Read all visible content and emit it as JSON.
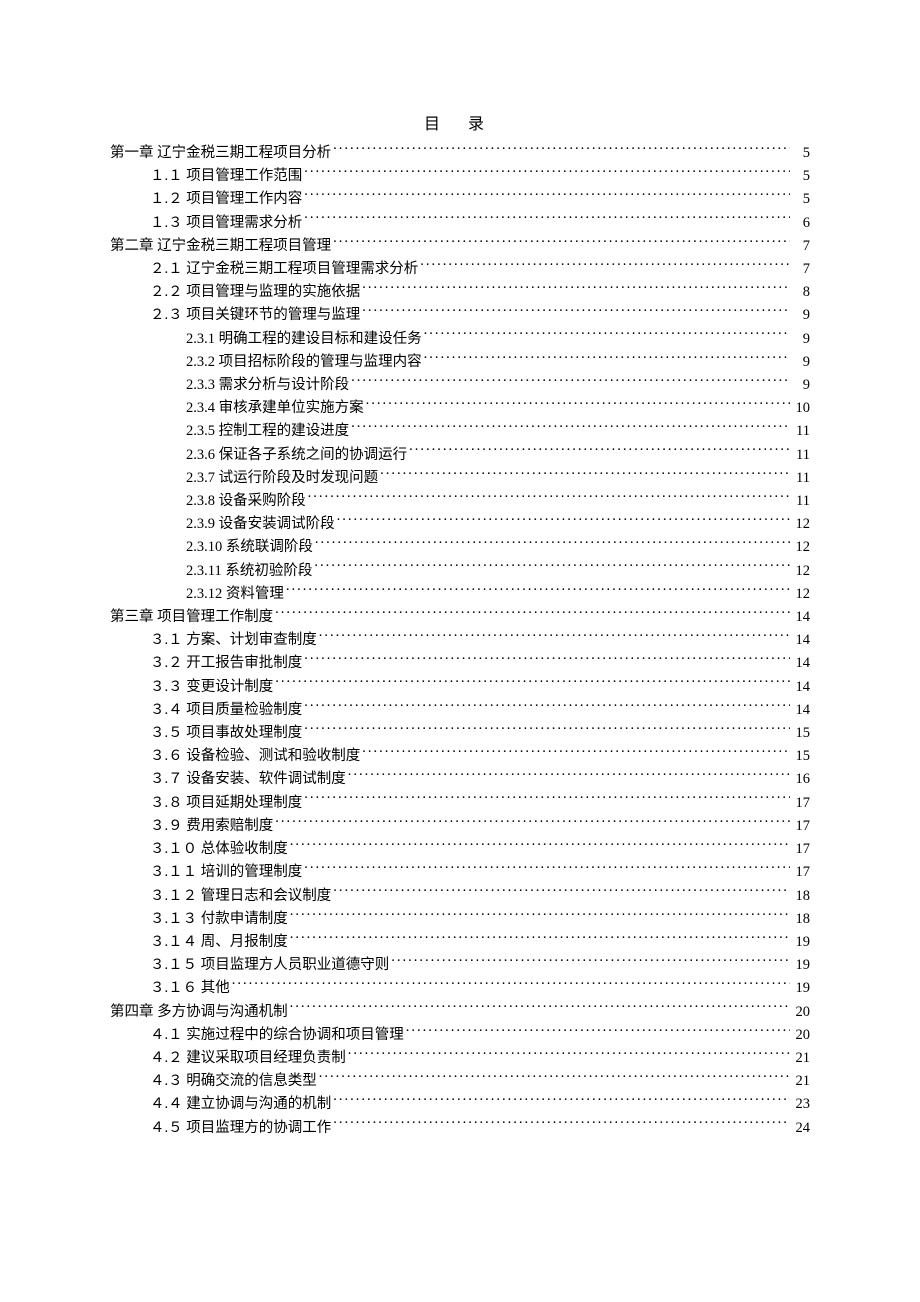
{
  "title": "目  录",
  "toc": [
    {
      "level": 0,
      "label": "第一章 辽宁金税三期工程项目分析",
      "page": "5"
    },
    {
      "level": 1,
      "label": "１.１ 项目管理工作范围",
      "page": "5"
    },
    {
      "level": 1,
      "label": "１.２ 项目管理工作内容",
      "page": "5"
    },
    {
      "level": 1,
      "label": "１.３ 项目管理需求分析",
      "page": "6"
    },
    {
      "level": 0,
      "label": "第二章 辽宁金税三期工程项目管理",
      "page": "7"
    },
    {
      "level": 1,
      "label": "２.１ 辽宁金税三期工程项目管理需求分析",
      "page": "7"
    },
    {
      "level": 1,
      "label": "２.２ 项目管理与监理的实施依据",
      "page": "8"
    },
    {
      "level": 1,
      "label": "２.３ 项目关键环节的管理与监理",
      "page": "9"
    },
    {
      "level": 2,
      "label": "2.3.1 明确工程的建设目标和建设任务",
      "page": "9"
    },
    {
      "level": 2,
      "label": "2.3.2 项目招标阶段的管理与监理内容",
      "page": "9"
    },
    {
      "level": 2,
      "label": "2.3.3 需求分析与设计阶段",
      "page": "9"
    },
    {
      "level": 2,
      "label": "2.3.4 审核承建单位实施方案",
      "page": "10"
    },
    {
      "level": 2,
      "label": "2.3.5 控制工程的建设进度",
      "page": "11"
    },
    {
      "level": 2,
      "label": "2.3.6 保证各子系统之间的协调运行",
      "page": "11"
    },
    {
      "level": 2,
      "label": "2.3.7 试运行阶段及时发现问题",
      "page": "11"
    },
    {
      "level": 2,
      "label": "2.3.8 设备采购阶段",
      "page": "11"
    },
    {
      "level": 2,
      "label": "2.3.9 设备安装调试阶段",
      "page": "12"
    },
    {
      "level": 2,
      "label": "2.3.10 系统联调阶段",
      "page": "12"
    },
    {
      "level": 2,
      "label": "2.3.11 系统初验阶段",
      "page": "12"
    },
    {
      "level": 2,
      "label": "2.3.12 资料管理",
      "page": "12"
    },
    {
      "level": 0,
      "label": "第三章 项目管理工作制度",
      "page": "14"
    },
    {
      "level": 1,
      "label": "３.１ 方案、计划审查制度",
      "page": "14"
    },
    {
      "level": 1,
      "label": "３.２ 开工报告审批制度",
      "page": "14"
    },
    {
      "level": 1,
      "label": "３.３ 变更设计制度",
      "page": "14"
    },
    {
      "level": 1,
      "label": "３.４ 项目质量检验制度",
      "page": "14"
    },
    {
      "level": 1,
      "label": "３.５ 项目事故处理制度",
      "page": "15"
    },
    {
      "level": 1,
      "label": "３.６ 设备检验、测试和验收制度",
      "page": "15"
    },
    {
      "level": 1,
      "label": "３.７ 设备安装、软件调试制度",
      "page": "16"
    },
    {
      "level": 1,
      "label": "３.８ 项目延期处理制度",
      "page": "17"
    },
    {
      "level": 1,
      "label": "３.９ 费用索赔制度",
      "page": "17"
    },
    {
      "level": 1,
      "label": "３.１０ 总体验收制度",
      "page": "17"
    },
    {
      "level": 1,
      "label": "３.１１ 培训的管理制度",
      "page": "17"
    },
    {
      "level": 1,
      "label": "３.１２ 管理日志和会议制度",
      "page": "18"
    },
    {
      "level": 1,
      "label": "３.１３ 付款申请制度",
      "page": "18"
    },
    {
      "level": 1,
      "label": "３.１４ 周、月报制度",
      "page": "19"
    },
    {
      "level": 1,
      "label": "３.１５ 项目监理方人员职业道德守则",
      "page": "19"
    },
    {
      "level": 1,
      "label": "３.１６ 其他",
      "page": "19"
    },
    {
      "level": 0,
      "label": "第四章 多方协调与沟通机制",
      "page": "20"
    },
    {
      "level": 1,
      "label": "４.１ 实施过程中的综合协调和项目管理",
      "page": "20"
    },
    {
      "level": 1,
      "label": "４.２ 建议采取项目经理负责制",
      "page": "21"
    },
    {
      "level": 1,
      "label": "４.３ 明确交流的信息类型",
      "page": "21"
    },
    {
      "level": 1,
      "label": "４.４ 建立协调与沟通的机制",
      "page": "23"
    },
    {
      "level": 1,
      "label": "４.５ 项目监理方的协调工作",
      "page": "24"
    }
  ]
}
